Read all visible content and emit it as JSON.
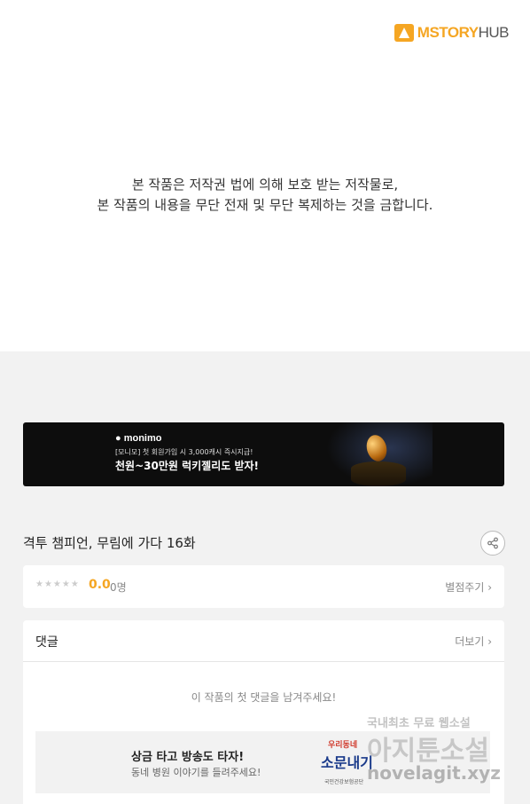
{
  "header": {
    "logo_main": "MSTORY",
    "logo_sub": "HUB"
  },
  "notice": {
    "line1": "본 작품은 저작권 법에 의해 보호 받는 저작물로,",
    "line2": "본 작품의 내용을 무단 전재 및 무단 복제하는 것을 금합니다."
  },
  "banner": {
    "brand": "monimo",
    "subtitle": "[모니모] 첫 회원가입 시 3,000캐시 즉시지급!",
    "headline": "천원~30만원 럭키젤리도 받자!"
  },
  "episode": {
    "title": "격투 챔피언, 무림에 가다 16화",
    "stars": "★★★★★",
    "score": "0.0",
    "rating_count": "0명",
    "give_rating_label": "별점주기 ›"
  },
  "comments": {
    "title": "댓글",
    "more_label": "더보기 ›",
    "empty_text": "이 작품의 첫 댓글을 남겨주세요!"
  },
  "promo": {
    "title": "상금 타고 방송도 타자!",
    "subtitle": "동네 병원 이야기를 들려주세요!",
    "art_top": "우리동네",
    "art_main": "소문내기",
    "art_bottom": "국민건강보험공단"
  },
  "watermark": {
    "line1": "국내최초 무료 웹소설",
    "line2": "아지툰소설",
    "line3": "novelagit.xyz"
  },
  "colors": {
    "accent": "#f5a623",
    "background": "#f2f2f2"
  }
}
